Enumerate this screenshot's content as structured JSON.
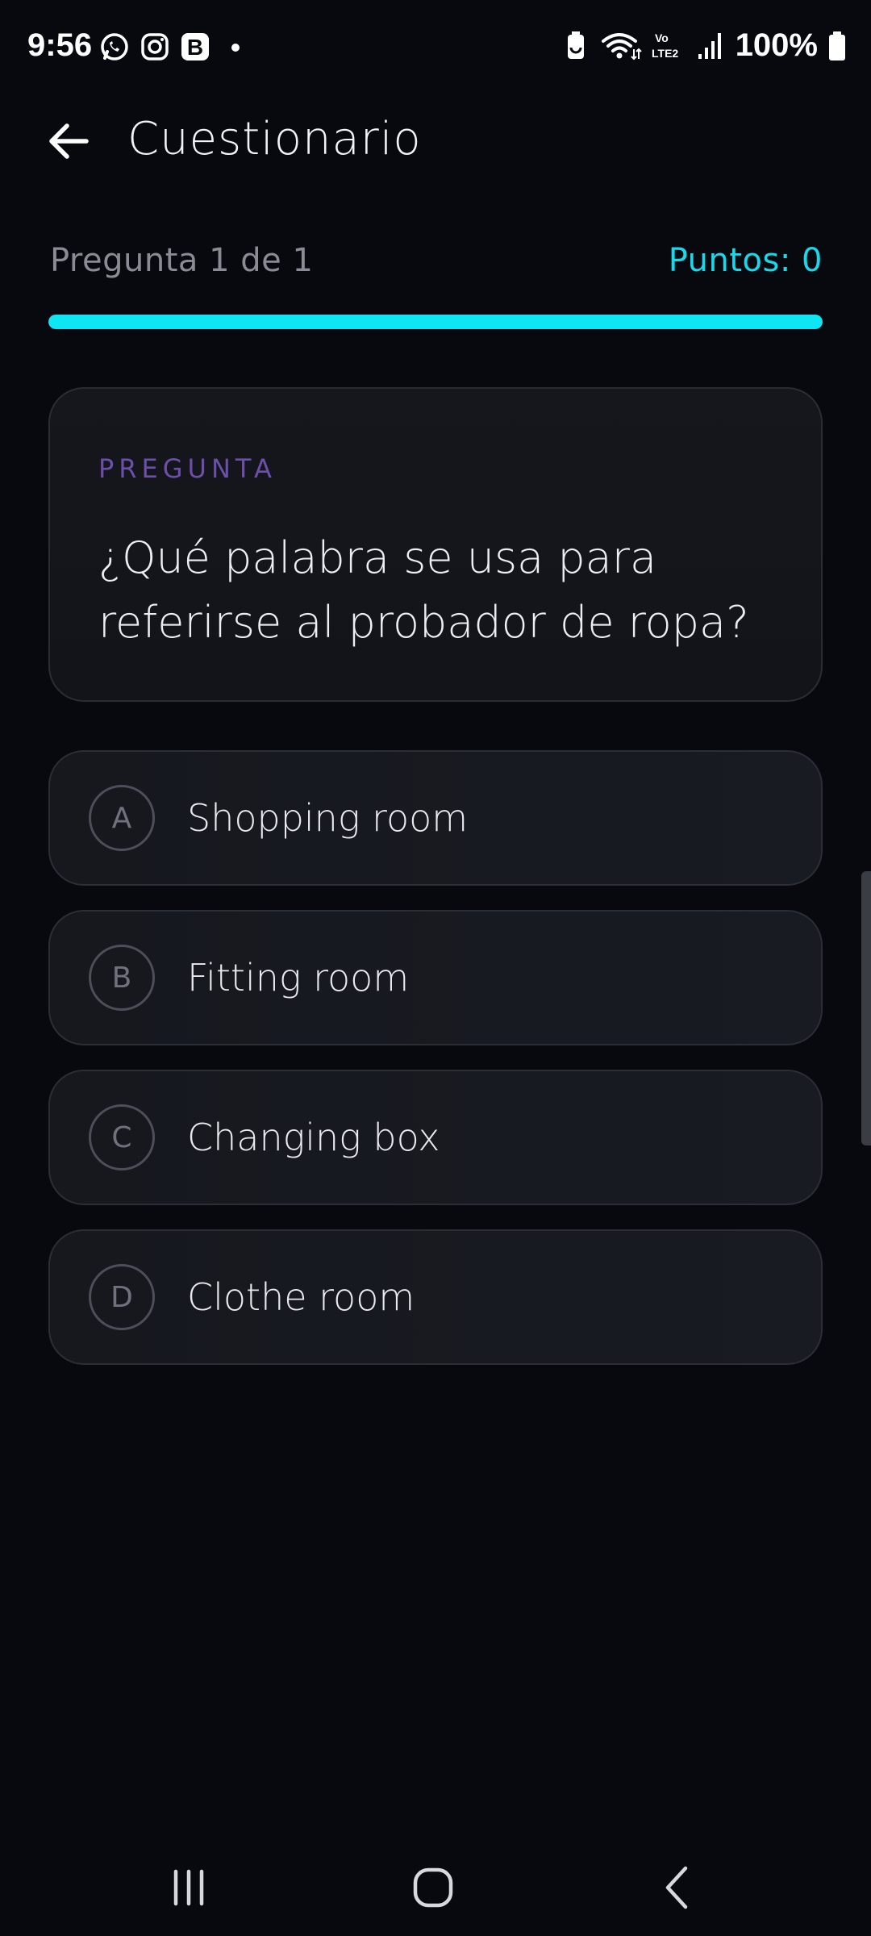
{
  "status_bar": {
    "time": "9:56",
    "battery": "100%",
    "left_icons": [
      "whatsapp-icon",
      "instagram-icon",
      "b-app-icon",
      "dot-icon"
    ],
    "right_icons": [
      "battery-saver-icon",
      "wifi-icon",
      "volte-icon",
      "signal-icon",
      "battery-icon"
    ],
    "volte_label": "Vo LTE2"
  },
  "app_bar": {
    "title": "Cuestionario"
  },
  "progress": {
    "counter": "Pregunta 1 de 1",
    "points": "Puntos: 0",
    "fraction": 1.0
  },
  "question": {
    "label": "PREGUNTA",
    "text": "¿Qué palabra se usa para referirse al probador de ropa?"
  },
  "options": [
    {
      "letter": "A",
      "text": "Shopping room"
    },
    {
      "letter": "B",
      "text": "Fitting room"
    },
    {
      "letter": "C",
      "text": "Changing box"
    },
    {
      "letter": "D",
      "text": "Clothe room"
    }
  ],
  "colors": {
    "background": "#07090e",
    "accent": "#0ee6f4",
    "label_purple": "#6b4fa8"
  }
}
